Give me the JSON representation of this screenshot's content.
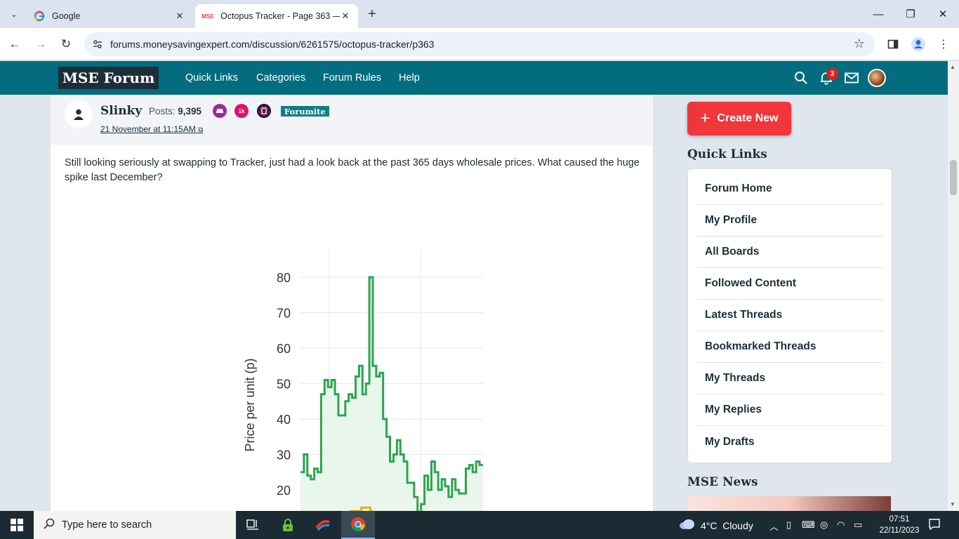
{
  "browser": {
    "tabs": [
      {
        "title": "Google",
        "favicon": "google-g"
      },
      {
        "title": "Octopus Tracker - Page 363 — M",
        "favicon": "MSE"
      }
    ],
    "url": "forums.moneysavingexpert.com/discussion/6261575/octopus-tracker/p363"
  },
  "header": {
    "logo": "MSE Forum",
    "nav": [
      "Quick Links",
      "Categories",
      "Forum Rules",
      "Help"
    ],
    "notification_count": "3",
    "colors": {
      "header_bg": "#036c7e",
      "logo_bg": "#1e2e39",
      "accent": "#f0353b"
    }
  },
  "post": {
    "author": "Slinky",
    "posts_label": "Posts:",
    "posts_count": "9,395",
    "rank_badge_1k": "1k",
    "role": "Forumite",
    "date": "21 November at 11:15AM",
    "body": "Still looking seriously at swapping to Tracker, just had a look back at the past 365 days wholesale prices.  What caused the huge spike last December?"
  },
  "chart_data": {
    "type": "line",
    "ylabel": "Price per unit (p)",
    "yticks": [
      20,
      30,
      40,
      50,
      60,
      70,
      80
    ],
    "ylim": [
      12,
      88
    ],
    "grid": true,
    "series": [
      {
        "color": "#2da44e",
        "fill": "#e9f6ec",
        "values": [
          25,
          30,
          24,
          23,
          26,
          25,
          47,
          51,
          49,
          51,
          47,
          41,
          41,
          45,
          47,
          46,
          52,
          55,
          47,
          50,
          80,
          55,
          52,
          53,
          40,
          35,
          28,
          30,
          34,
          30,
          28,
          22,
          22,
          18,
          13,
          16,
          24,
          20,
          28,
          25,
          20,
          23,
          21,
          18,
          23,
          20,
          19,
          19,
          26,
          27,
          25,
          28,
          27
        ]
      },
      {
        "color": "#e0b21a",
        "values": [
          14,
          14,
          14,
          14,
          15,
          15,
          15,
          14
        ]
      }
    ]
  },
  "sidebar": {
    "create_new": "Create New",
    "quick_links_heading": "Quick Links",
    "quick_links": [
      "Forum Home",
      "My Profile",
      "All Boards",
      "Followed Content",
      "Latest Threads",
      "Bookmarked Threads",
      "My Threads",
      "My Replies",
      "My Drafts"
    ],
    "news_heading": "MSE News"
  },
  "taskbar": {
    "search_placeholder": "Type here to search",
    "weather": "4°C  Cloudy",
    "time": "07:51",
    "date": "22/11/2023"
  }
}
